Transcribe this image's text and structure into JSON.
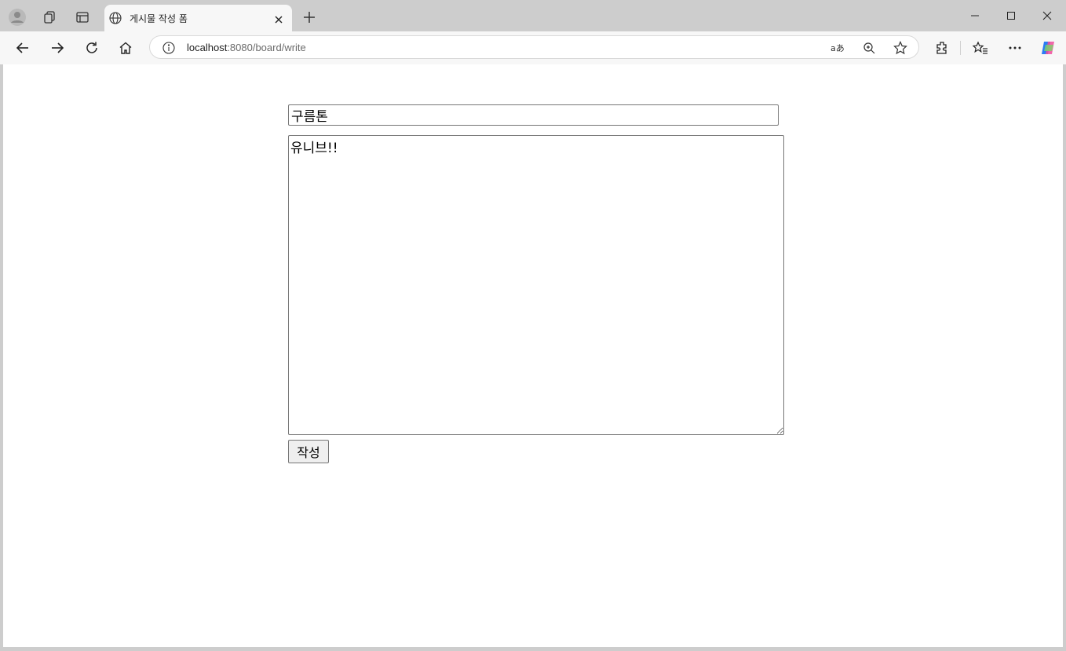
{
  "browser": {
    "tab_title": "게시물 작성 폼",
    "url_host": "localhost",
    "url_path": ":8080/board/write"
  },
  "form": {
    "title_value": "구름톤",
    "content_value": "유니브!!",
    "submit_label": "작성"
  }
}
